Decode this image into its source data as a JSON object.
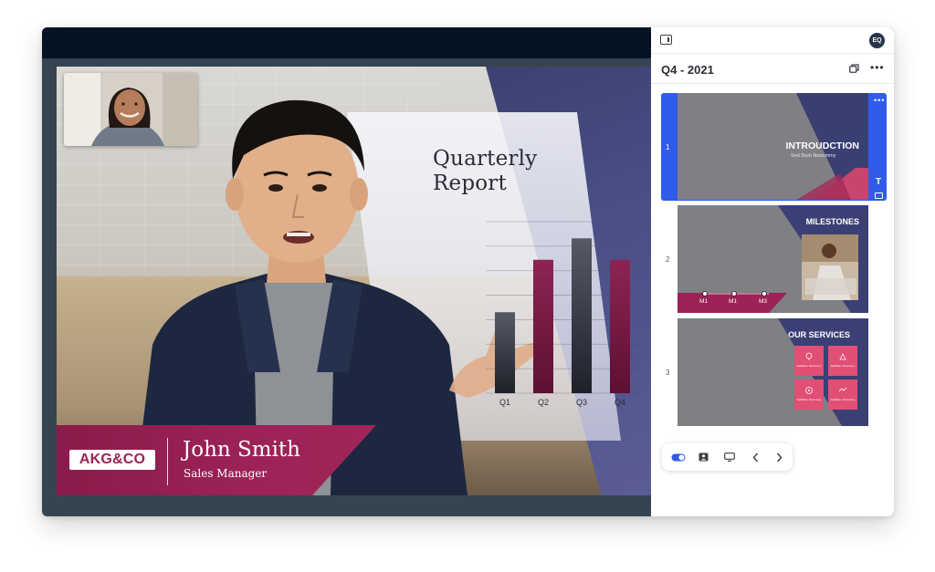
{
  "colors": {
    "accent_blue": "#2f5bea",
    "brand_magenta": "#9c2257",
    "top_bar": "#061325",
    "navy": "#27344a"
  },
  "slide": {
    "title_line1": "Quarterly",
    "title_line2": "Report",
    "lower_third": {
      "logo": "AKG&CO",
      "name": "John Smith",
      "role": "Sales Manager"
    }
  },
  "chart_data": {
    "type": "bar",
    "categories": [
      "Q1",
      "Q2",
      "Q3",
      "Q4"
    ],
    "values": [
      34,
      56,
      65,
      56
    ],
    "ylim": [
      0,
      72
    ],
    "grid": true,
    "legend": "none"
  },
  "panel": {
    "avatar_initials": "EQ",
    "deck_title": "Q4 - 2021",
    "slides": [
      {
        "number": "1",
        "heading": "INTROUDCTION",
        "subtitle": "Sed Dum Nonummy"
      },
      {
        "number": "2",
        "heading": "MILESTONES",
        "milestones": [
          "M1",
          "M1",
          "M3"
        ]
      },
      {
        "number": "3",
        "heading": "OUR SERVICES",
        "card_label": "SedDiam Nonummy"
      }
    ]
  }
}
